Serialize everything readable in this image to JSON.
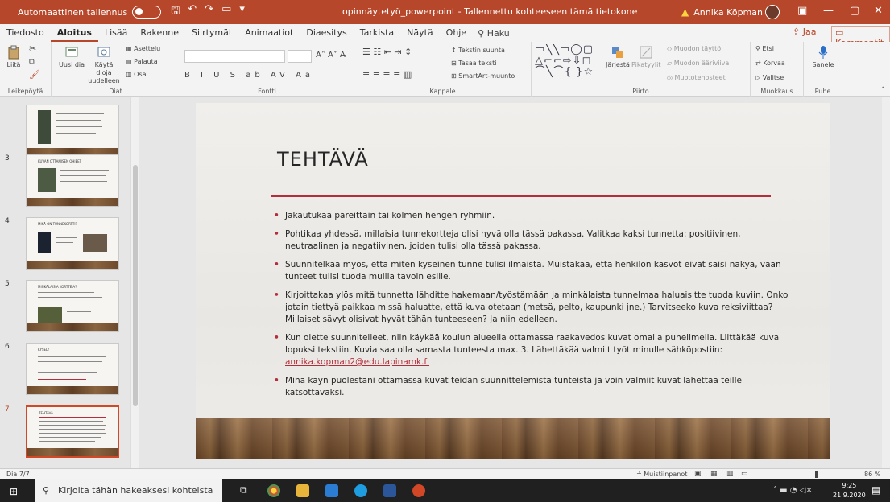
{
  "titlebar": {
    "autosave_label": "Automaattinen tallennus",
    "document_title": "opinnäytetyö_powerpoint - Tallennettu kohteeseen tämä tietokone",
    "user_name": "Annika Köpman"
  },
  "menu": {
    "tabs": [
      "Tiedosto",
      "Aloitus",
      "Lisää",
      "Rakenne",
      "Siirtymät",
      "Animaatiot",
      "Diaesitys",
      "Tarkista",
      "Näytä",
      "Ohje"
    ],
    "active_tab": "Aloitus",
    "search_label": "Haku",
    "share_label": "Jaa",
    "comments_label": "Kommentit"
  },
  "ribbon": {
    "clipboard": {
      "label": "Leikepöytä",
      "paste": "Liitä"
    },
    "slides": {
      "label": "Diat",
      "new_slide": "Uusi dia",
      "reuse": "Käytä dioja uudelleen",
      "layout": "Asettelu",
      "reset": "Palauta",
      "section": "Osa"
    },
    "font": {
      "label": "Fontti",
      "format_row": "B I U S ab AV Aa"
    },
    "paragraph": {
      "label": "Kappale",
      "text_direction": "Tekstin suunta",
      "align_text": "Tasaa teksti",
      "smartart": "SmartArt-muunto"
    },
    "drawing": {
      "label": "Piirto",
      "arrange": "Järjestä",
      "quick_styles": "Pikatyylit",
      "shape_fill": "Muodon täyttö",
      "shape_outline": "Muodon ääriviiva",
      "shape_effects": "Muototehosteet"
    },
    "editing": {
      "label": "Muokkaus",
      "find": "Etsi",
      "replace": "Korvaa",
      "select": "Valitse"
    },
    "voice": {
      "label": "Puhe",
      "dictate": "Sanele"
    }
  },
  "thumbnails": [
    {
      "number": "",
      "title": ""
    },
    {
      "number": "3",
      "title": "KUVAN OTTAMISEN OHJEET"
    },
    {
      "number": "4",
      "title": "MIKÄ ON TUNNEKORTTI?"
    },
    {
      "number": "5",
      "title": "MINKÄLAISIA KORTTEJA?"
    },
    {
      "number": "6",
      "title": "KYSELY"
    },
    {
      "number": "7",
      "title": "TEHTÄVÄ"
    }
  ],
  "slide": {
    "title": "TEHTÄVÄ",
    "bullets": [
      "Jakautukaa pareittain tai kolmen hengen ryhmiin.",
      "Pohtikaa yhdessä, millaisia tunnekortteja olisi hyvä olla tässä pakassa. Valitkaa kaksi tunnetta: positiivinen, neutraalinen ja negatiivinen, joiden tulisi olla tässä pakassa.",
      "Suunnitelkaa myös, että miten kyseinen tunne tulisi ilmaista. Muistakaa, että henkilön kasvot eivät saisi näkyä, vaan tunteet tulisi tuoda muilla tavoin esille.",
      "Kirjoittakaa ylös mitä tunnetta lähditte hakemaan/työstämään ja minkälaista tunnelmaa haluaisitte tuoda kuviin. Onko jotain tiettyä paikkaa missä haluatte, että kuva otetaan (metsä, pelto, kaupunki jne.) Tarvitseeko kuva reksiviittaa? Millaiset sävyt olisivat hyvät tähän tunteeseen? Ja niin edelleen.",
      "Kun olette suunnitelleet, niin käykää koulun alueella ottamassa raakavedos kuvat omalla puhelimella. Liittäkää kuva lopuksi tekstiin. Kuvia saa olla samasta tunteesta max. 3. Lähettäkää valmiit työt minulle sähköpostiin:",
      "Minä käyn puolestani ottamassa kuvat teidän suunnittelemista tunteista ja voin valmiit kuvat lähettää teille katsottavaksi."
    ],
    "email": "annika.kopman2@edu.lapinamk.fi"
  },
  "status": {
    "slide_counter": "Dia 7/7",
    "notes_label": "Muistiinpanot",
    "zoom": "86 %"
  },
  "taskbar": {
    "search_placeholder": "Kirjoita tähän hakeaksesi kohteista",
    "time": "9:25",
    "date": "21.9.2020"
  },
  "colors": {
    "accent": "#b7472a",
    "slide_rule": "#b52d3a"
  }
}
